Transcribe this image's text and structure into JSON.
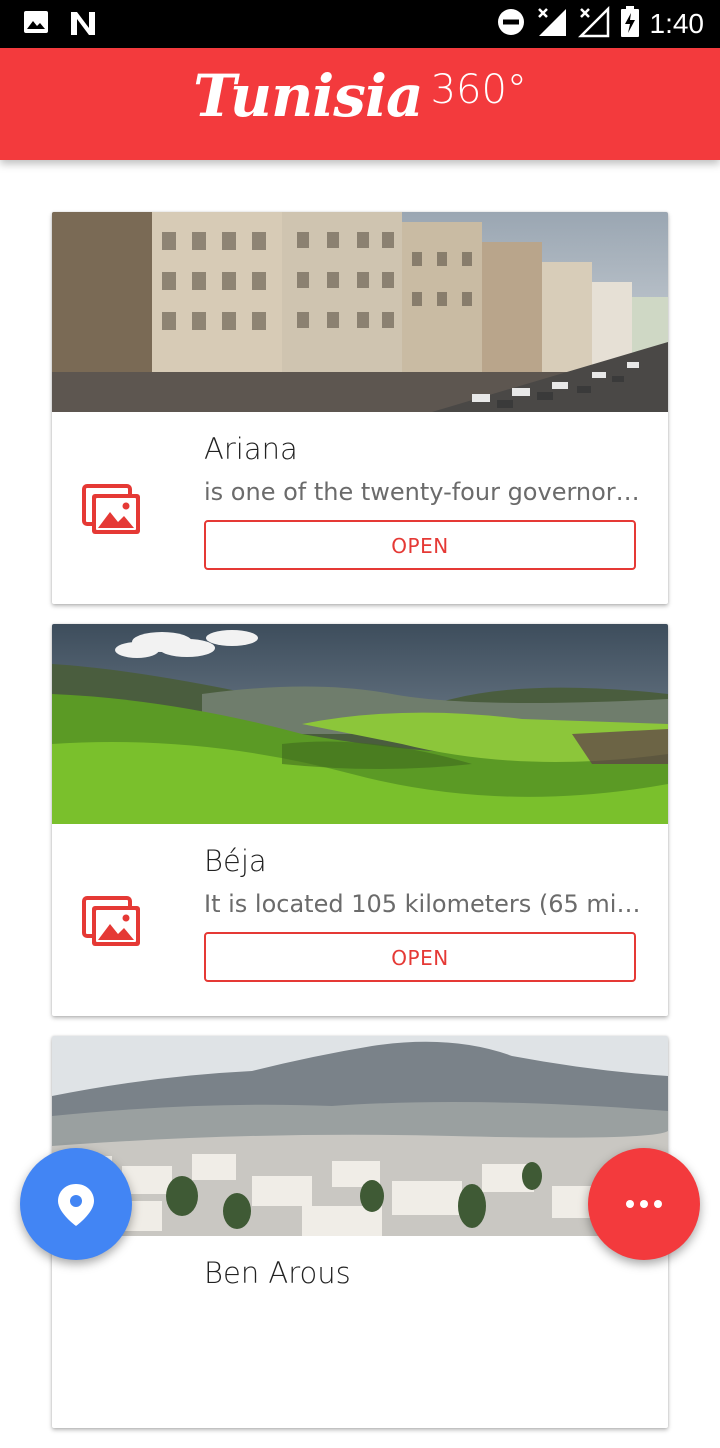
{
  "status_bar": {
    "time": "1:40",
    "left_icons": [
      "image-notification-icon",
      "n-notification-icon"
    ],
    "right_icons": [
      "do-not-disturb-icon",
      "signal-no-data-icon",
      "signal-no-service-icon",
      "battery-charging-icon"
    ]
  },
  "app_bar": {
    "brand_script": "Tunisia",
    "brand_suffix": "360°"
  },
  "accent_color": "#f33a3d",
  "fab_location_color": "#4285f4",
  "cards": [
    {
      "title": "Ariana",
      "description": "is one of the twenty-four governora…",
      "button_label": "OPEN",
      "image_icon": "photo-gallery-icon"
    },
    {
      "title": "Béja",
      "description": "It is located 105 kilometers (65 mi) f…",
      "button_label": "OPEN",
      "image_icon": "photo-gallery-icon"
    },
    {
      "title": "Ben Arous",
      "description": "",
      "button_label": "",
      "image_icon": "photo-gallery-icon"
    }
  ],
  "fabs": {
    "location_icon": "location-pin-icon",
    "more_icon": "more-horizontal-icon"
  }
}
